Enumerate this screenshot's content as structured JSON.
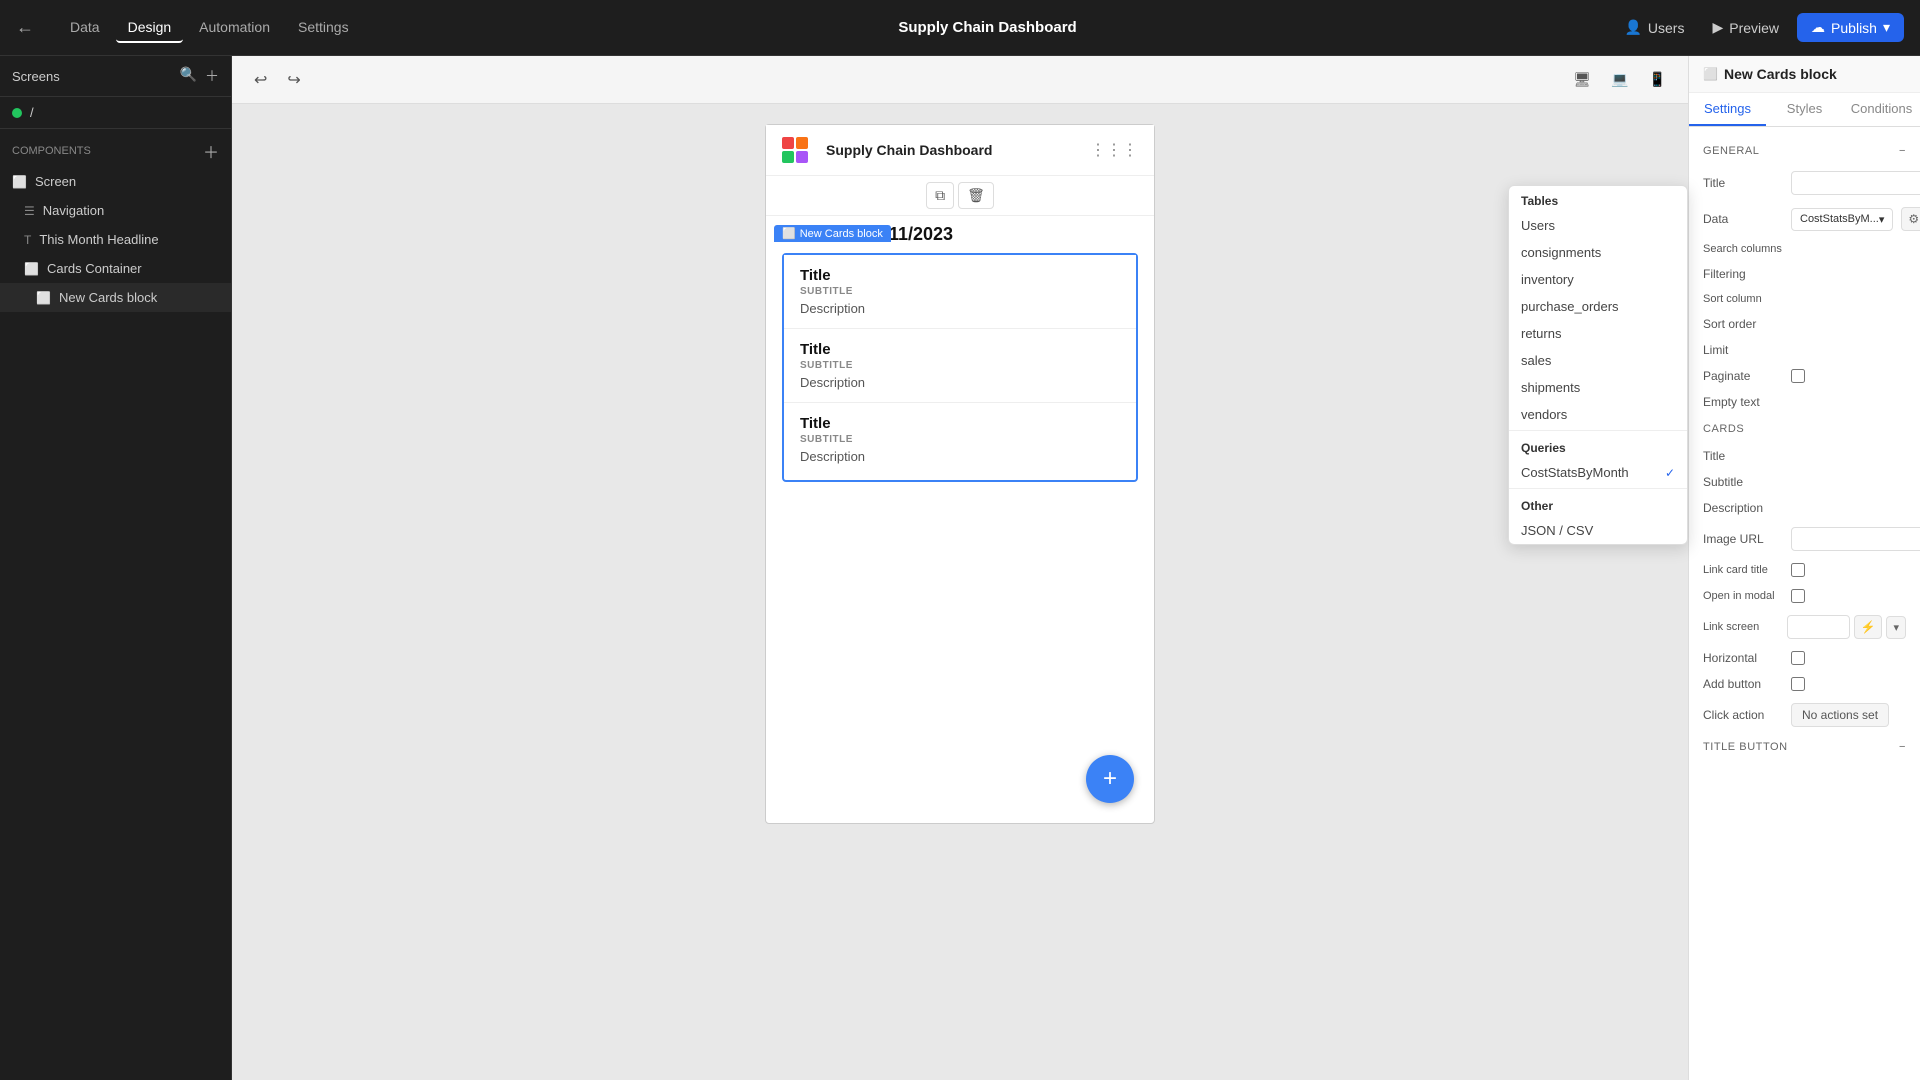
{
  "topNav": {
    "back_icon": "←",
    "tabs": [
      "Data",
      "Design",
      "Automation",
      "Settings"
    ],
    "active_tab": "Design",
    "app_title": "Supply Chain Dashboard",
    "users_label": "Users",
    "preview_label": "Preview",
    "publish_label": "Publish"
  },
  "leftSidebar": {
    "title": "Screens",
    "root_item": "/",
    "components_label": "Components",
    "tree_items": [
      {
        "label": "Screen",
        "icon": "⬜",
        "indent": 0
      },
      {
        "label": "Navigation",
        "icon": "☰",
        "indent": 1
      },
      {
        "label": "This Month Headline",
        "icon": "T",
        "indent": 1
      },
      {
        "label": "Cards Container",
        "icon": "⬜",
        "indent": 1
      },
      {
        "label": "New Cards block",
        "icon": "⬜",
        "indent": 2,
        "active": true
      }
    ]
  },
  "canvas": {
    "undo_icon": "↩",
    "redo_icon": "↪",
    "viewport_desktop": "🖥",
    "viewport_tablet": "💻",
    "viewport_mobile": "📱",
    "app_title": "Supply Chain Dashboard",
    "this_month_headline": "This Month: 11/2023",
    "new_cards_block_label": "New Cards block",
    "cards": [
      {
        "title": "Title",
        "subtitle": "SUBTITLE",
        "description": "Description"
      },
      {
        "title": "Title",
        "subtitle": "SUBTITLE",
        "description": "Description"
      },
      {
        "title": "Title",
        "subtitle": "SUBTITLE",
        "description": "Description"
      }
    ],
    "fab_icon": "+"
  },
  "rightPanel": {
    "title": "New Cards block",
    "icon": "⬜",
    "tabs": [
      "Settings",
      "Styles",
      "Conditions"
    ],
    "active_tab": "Settings",
    "general_label": "GENERAL",
    "fields": {
      "title_label": "Title",
      "title_value": "",
      "data_label": "Data",
      "data_value": "CostStatsByM...",
      "search_columns_label": "Search columns",
      "filtering_label": "Filtering",
      "sort_column_label": "Sort column",
      "sort_order_label": "Sort order",
      "limit_label": "Limit",
      "paginate_label": "Paginate",
      "empty_text_label": "Empty text"
    },
    "cards_label": "CARDS",
    "cards_fields": {
      "title_label": "Title",
      "subtitle_label": "Subtitle",
      "description_label": "Description",
      "image_url_label": "Image URL",
      "link_card_title_label": "Link card title",
      "open_in_modal_label": "Open in modal",
      "link_screen_label": "Link screen",
      "horizontal_label": "Horizontal",
      "add_button_label": "Add button",
      "click_action_label": "Click action",
      "click_action_value": "No actions set"
    },
    "title_button_label": "TITLE BUTTON"
  },
  "dropdown": {
    "tables_label": "Tables",
    "table_items": [
      "Users",
      "consignments",
      "inventory",
      "purchase_orders",
      "returns",
      "sales",
      "shipments",
      "vendors"
    ],
    "queries_label": "Queries",
    "query_items": [
      "CostStatsByMonth"
    ],
    "selected_query": "CostStatsByMonth",
    "other_label": "Other",
    "other_items": [
      "JSON / CSV"
    ]
  }
}
